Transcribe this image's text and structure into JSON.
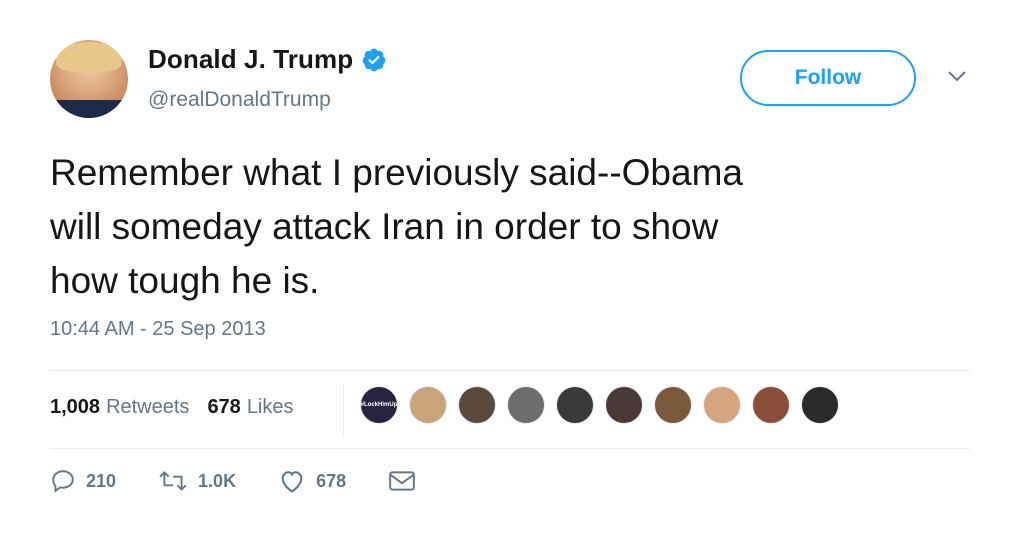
{
  "user": {
    "display_name": "Donald J. Trump",
    "handle": "@realDonaldTrump",
    "verified": true
  },
  "follow_button": {
    "label": "Follow"
  },
  "tweet": {
    "lines": [
      "Remember what I previously said--Obama",
      "will someday attack Iran in order to show",
      "how tough he is."
    ],
    "timestamp": "10:44 AM - 25 Sep 2013"
  },
  "stats": {
    "retweets_count": "1,008",
    "retweets_label": "Retweets",
    "likes_count": "678",
    "likes_label": "Likes"
  },
  "liker_avatars": [
    {
      "bg": "#2a2340",
      "tag": "#LockHimUp"
    },
    {
      "bg": "#c9a47a",
      "tag": ""
    },
    {
      "bg": "#5a4a3e",
      "tag": ""
    },
    {
      "bg": "#6d6d6d",
      "tag": ""
    },
    {
      "bg": "#3a3a3a",
      "tag": ""
    },
    {
      "bg": "#4a3a35",
      "tag": ""
    },
    {
      "bg": "#7a5a3a",
      "tag": ""
    },
    {
      "bg": "#d4a57e",
      "tag": ""
    },
    {
      "bg": "#8a4f3a",
      "tag": ""
    },
    {
      "bg": "#2a2a2a",
      "tag": ""
    }
  ],
  "actions": {
    "reply_count": "210",
    "retweet_count": "1.0K",
    "like_count": "678"
  },
  "icons": {
    "reply": "reply-icon",
    "retweet": "retweet-icon",
    "like": "heart-icon",
    "dm": "envelope-icon",
    "more": "chevron-down-icon",
    "verified": "verified-badge-icon"
  },
  "colors": {
    "accent": "#1da1f2",
    "text": "#14171a",
    "secondary": "#657786",
    "divider": "#e6ecf0"
  }
}
